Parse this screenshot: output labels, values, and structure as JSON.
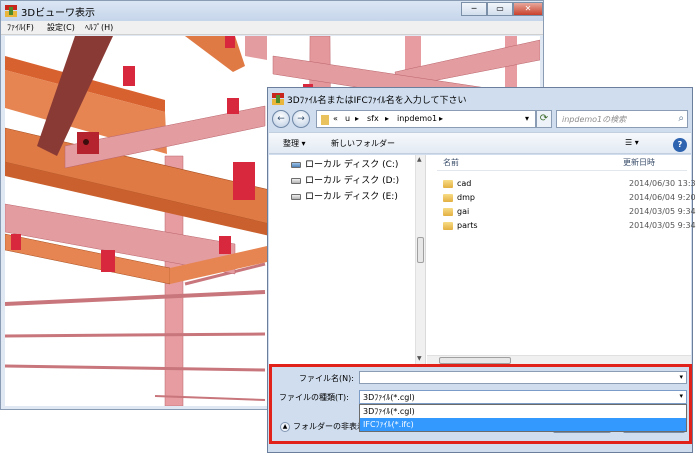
{
  "viewer": {
    "title": "3Dビューワ表示",
    "menus": [
      "ﾌｧｲﾙ(F)",
      "設定(C)",
      "ﾍﾙﾌﾟ(H)"
    ],
    "window_buttons": {
      "minimize": "─",
      "restore": "▭",
      "close": "✕"
    }
  },
  "dialog": {
    "title": "3Dﾌｧｲﾙ名またはIFCﾌｧｲﾙ名を入力して下さい",
    "nav_back": "←",
    "nav_forward": "→",
    "breadcrumb": [
      "«",
      "u",
      "sfx",
      "inpdemo1"
    ],
    "search_placeholder": "inpdemo1の検索",
    "toolbar": {
      "organize": "整理 ▾",
      "new_folder": "新しいフォルダー",
      "view": "☰ ▾",
      "help": "?"
    },
    "drives": [
      "ローカル ディスク (C:)",
      "ローカル ディスク (D:)",
      "ローカル ディスク (E:)"
    ],
    "columns": {
      "name": "名前",
      "date": "更新日時"
    },
    "files": [
      {
        "name": "cad",
        "date": "2014/06/30 13:38"
      },
      {
        "name": "dmp",
        "date": "2014/06/04 9:20"
      },
      {
        "name": "gai",
        "date": "2014/03/05 9:34"
      },
      {
        "name": "parts",
        "date": "2014/03/05 9:34"
      }
    ],
    "filename_label": "ファイル名(N):",
    "filename_value": "",
    "filetype_label": "ファイルの種類(T):",
    "filetype_selected": "3Dﾌｧｲﾙ(*.cgl)",
    "filetype_options": [
      "3Dﾌｧｲﾙ(*.cgl)",
      "IFCﾌｧｲﾙ(*.ifc)"
    ],
    "hide_folders": "フォルダーの非表示",
    "open_button_partial": "く ▾",
    "cancel_button_partial": "ル"
  },
  "colors": {
    "highlight": "#e0221a",
    "beam_orange": "#e07a45",
    "beam_pink": "#e08a8e",
    "plate_red": "#d8283d",
    "selection": "#3399ff"
  }
}
